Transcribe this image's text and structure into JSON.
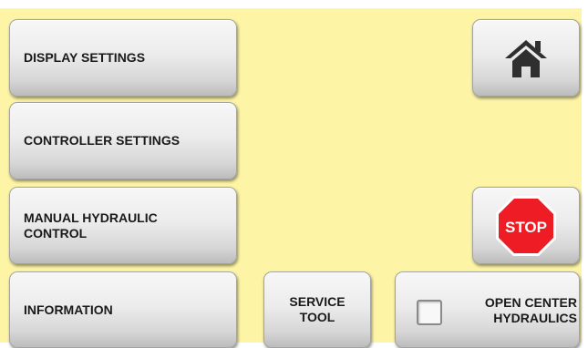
{
  "menu": {
    "display_settings": "DISPLAY SETTINGS",
    "controller_settings": "CONTROLLER SETTINGS",
    "manual_hydraulic_control": {
      "line1": "MANUAL HYDRAULIC",
      "line2": "CONTROL"
    },
    "information": "INFORMATION"
  },
  "service_tool": {
    "line1": "SERVICE",
    "line2": "TOOL"
  },
  "open_center": {
    "line1": "OPEN CENTER",
    "line2": "HYDRAULICS",
    "checked": false
  },
  "home_button": {
    "icon": "home-icon"
  },
  "stop_button": {
    "icon": "stop-sign-icon",
    "label": "STOP"
  },
  "colors": {
    "background": "#fdf4a6",
    "stop_red": "#ee1c24",
    "icon_dark": "#2f2f2f"
  }
}
